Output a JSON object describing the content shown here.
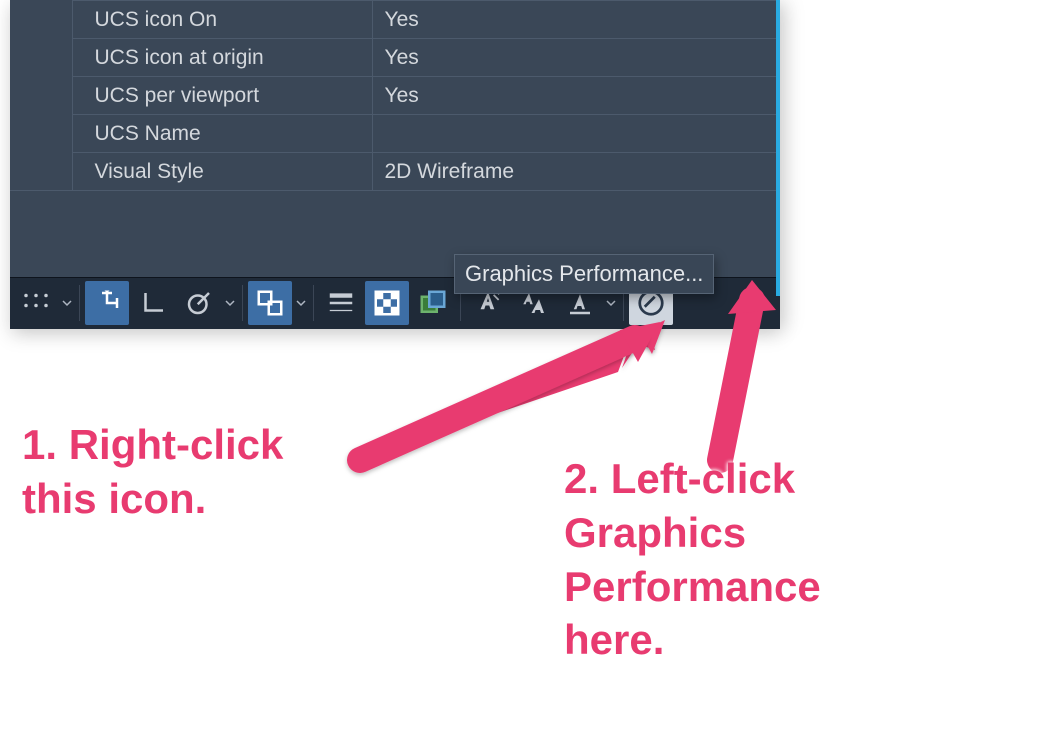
{
  "properties": [
    {
      "label": "UCS icon On",
      "value": "Yes"
    },
    {
      "label": "UCS icon at origin",
      "value": "Yes"
    },
    {
      "label": "UCS per viewport",
      "value": "Yes"
    },
    {
      "label": "UCS Name",
      "value": ""
    },
    {
      "label": "Visual Style",
      "value": "2D Wireframe"
    }
  ],
  "context_menu": {
    "item": "Graphics Performance..."
  },
  "annotations": {
    "step1": "1. Right-click\nthis icon.",
    "step2": "2. Left-click\nGraphics\nPerformance\nhere."
  },
  "icons": {
    "grid": "grid-icon",
    "ortho": "ortho-icon",
    "polar": "polar-icon",
    "osnap": "osnap-icon",
    "lineweight": "lineweight-icon",
    "transparency": "transparency-icon",
    "cycling": "cycling-icon",
    "annoscale": "anno-scale-icon",
    "annovis": "anno-visibility-icon",
    "annoauto": "anno-auto-icon",
    "perf": "performance-icon"
  },
  "colors": {
    "panel": "#3a4757",
    "accent_pink": "#e83b70",
    "accent_blue": "#29abe2",
    "active_btn": "#3d6ea5"
  }
}
